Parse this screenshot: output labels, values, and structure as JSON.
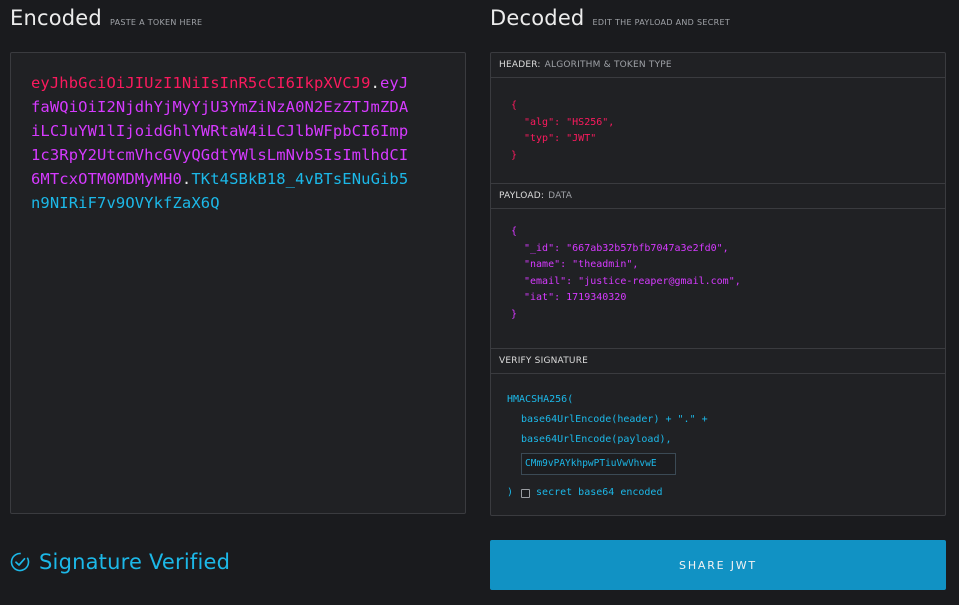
{
  "encoded": {
    "title": "Encoded",
    "subtitle": "PASTE A TOKEN HERE",
    "token_header": "eyJhbGciOiJIUzI1NiIsInR5cCI6IkpXVCJ9",
    "token_payload": "eyJfaWQiOiI2NjdhYjMyYjU3YmZiNzA0N2EzZTJmZDAiLCJuYW1lIjoidGhlYWRtaW4iLCJlbWFpbCI6Imp1c3RpY2UtcmVhcGVyQGdtYWlsLmNvbSIsImlhdCI6MTcxOTM0MDMyMH0",
    "token_signature": "TKt4SBkB18_4vBTsENuGib5n9NIRiF7v9OVYkfZaX6Q",
    "dot": "."
  },
  "decoded": {
    "title": "Decoded",
    "subtitle": "EDIT THE PAYLOAD AND SECRET",
    "header_section": {
      "label": "HEADER:",
      "sublabel": "ALGORITHM & TOKEN TYPE"
    },
    "header_json": {
      "open": "{",
      "alg_line": "\"alg\": \"HS256\",",
      "typ_line": "\"typ\": \"JWT\"",
      "close": "}"
    },
    "payload_section": {
      "label": "PAYLOAD:",
      "sublabel": "DATA"
    },
    "payload_json": {
      "open": "{",
      "id_line": "\"_id\": \"667ab32b57bfb7047a3e2fd0\",",
      "name_line": "\"name\": \"theadmin\",",
      "email_line": "\"email\": \"justice-reaper@gmail.com\",",
      "iat_line": "\"iat\": 1719340320",
      "close": "}"
    },
    "signature_section": {
      "label": "VERIFY SIGNATURE"
    },
    "signature": {
      "fn": "HMACSHA256(",
      "line1": "base64UrlEncode(header) + \".\" +",
      "line2": "base64UrlEncode(payload),",
      "secret_value": "CMm9vPAYkhpwPTiuVwVhvwE",
      "close": ")",
      "checkbox_label": "secret base64 encoded",
      "checkbox_checked": false
    }
  },
  "status": {
    "text": "Signature Verified",
    "icon": "check-circle-icon"
  },
  "share_button": {
    "label": "SHARE JWT"
  },
  "colors": {
    "header": "#fb1a5e",
    "payload": "#d63aff",
    "signature": "#1cb8e8",
    "button": "#1192c4",
    "background": "#1a1b1e"
  }
}
